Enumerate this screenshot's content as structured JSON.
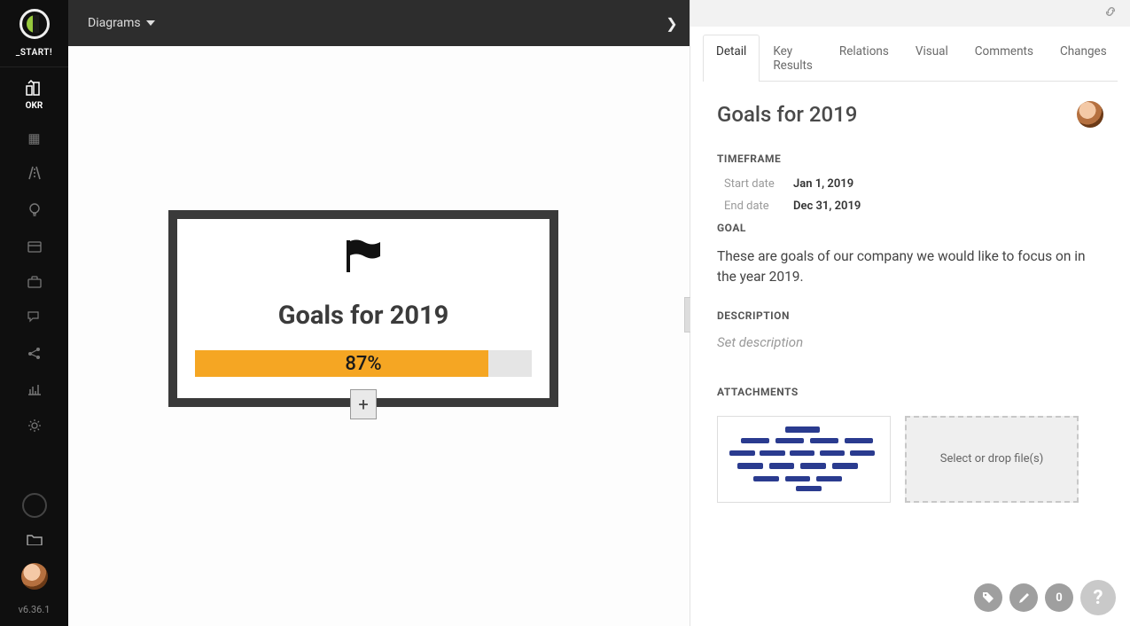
{
  "sidebar": {
    "start_label": "_START!",
    "items": [
      {
        "icon": "okr-icon",
        "label": "OKR"
      },
      {
        "icon": "grid-icon"
      },
      {
        "icon": "road-icon"
      },
      {
        "icon": "bulb-icon"
      },
      {
        "icon": "card-icon"
      },
      {
        "icon": "briefcase-icon"
      },
      {
        "icon": "chat-icon"
      },
      {
        "icon": "share-icon"
      },
      {
        "icon": "chart-icon"
      },
      {
        "icon": "gear-icon"
      }
    ],
    "version": "v6.36.1"
  },
  "topbar": {
    "menu_label": "Diagrams"
  },
  "card": {
    "title": "Goals for 2019",
    "progress_pct": 87,
    "progress_label": "87%",
    "add_label": "+"
  },
  "panel": {
    "tabs": [
      "Detail",
      "Key Results",
      "Relations",
      "Visual",
      "Comments",
      "Changes"
    ],
    "active_tab": 0,
    "title": "Goals for 2019",
    "sections": {
      "timeframe_h": "TIMEFRAME",
      "start_k": "Start date",
      "start_v": "Jan 1, 2019",
      "end_k": "End date",
      "end_v": "Dec 31, 2019",
      "goal_h": "GOAL",
      "goal_text": "These are goals of our company we would like to focus on in the year 2019.",
      "desc_h": "DESCRIPTION",
      "desc_placeholder": "Set description",
      "attach_h": "ATTACHMENTS",
      "dropzone": "Select or drop file(s)"
    },
    "fab_count": "0"
  }
}
